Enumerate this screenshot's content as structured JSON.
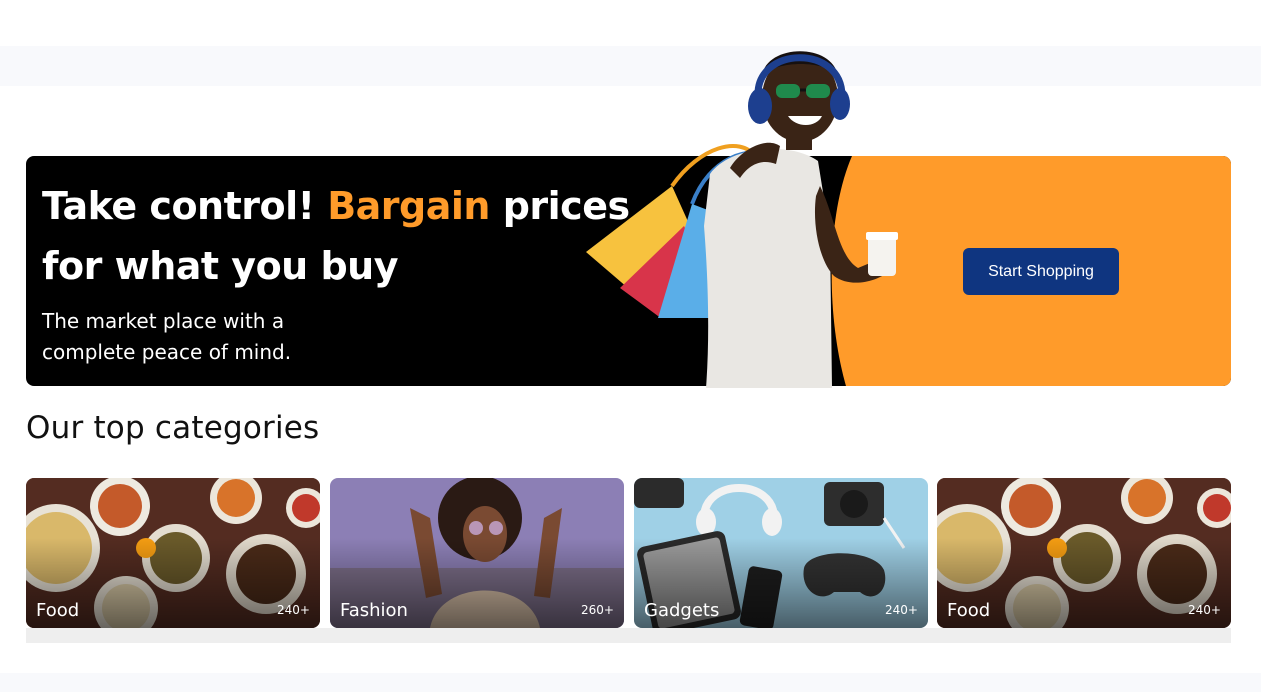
{
  "hero": {
    "title_part1": "Take control! ",
    "title_accent": "Bargain",
    "title_part2": " prices for what you buy",
    "subtitle": "The market place with a complete peace of mind.",
    "cta_label": "Start Shopping",
    "colors": {
      "background": "#000000",
      "accent": "#ff9b2a",
      "cta": "#0f3580"
    }
  },
  "categories_section": {
    "title": "Our top categories",
    "items": [
      {
        "label": "Food",
        "count": "240+",
        "image": "food-photo"
      },
      {
        "label": "Fashion",
        "count": "260+",
        "image": "fashion-photo"
      },
      {
        "label": "Gadgets",
        "count": "240+",
        "image": "gadgets-photo"
      },
      {
        "label": "Food",
        "count": "240+",
        "image": "food-photo"
      }
    ]
  }
}
